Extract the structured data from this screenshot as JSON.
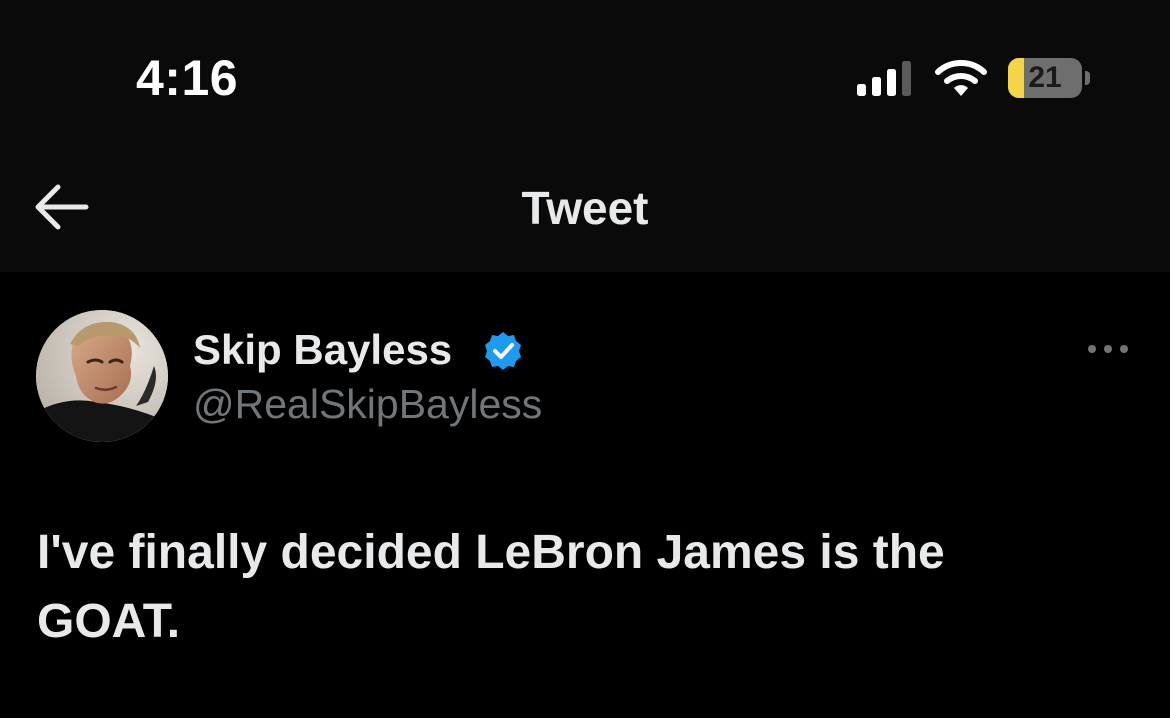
{
  "status_bar": {
    "time": "4:16",
    "battery_level": "21",
    "battery_fraction": 0.21,
    "icons": [
      "signal-icon",
      "wifi-icon",
      "battery-icon"
    ],
    "battery_color": "#f5d547"
  },
  "nav": {
    "back_icon": "back-arrow-icon",
    "title": "Tweet"
  },
  "tweet": {
    "author_name": "Skip Bayless",
    "author_handle": "@RealSkipBayless",
    "verified_icon": "verified-badge-icon",
    "verified_color": "#1d9bf0",
    "more_icon": "more-options-icon",
    "text": "I've finally decided LeBron James is the GOAT."
  },
  "colors": {
    "background": "#000000",
    "header_background": "#0a0a0a",
    "primary_text": "#e7e9ea",
    "secondary_text": "#71767b"
  }
}
